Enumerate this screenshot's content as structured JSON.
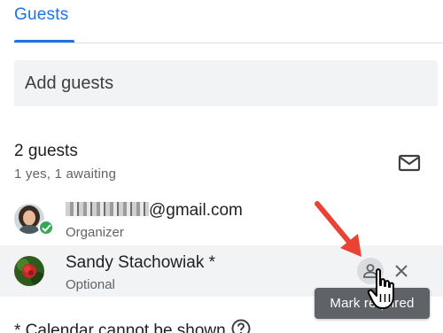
{
  "tab": {
    "label": "Guests"
  },
  "add_guests": {
    "placeholder": "Add guests"
  },
  "summary": {
    "count_label": "2 guests",
    "responses": "1 yes, 1 awaiting"
  },
  "guests": [
    {
      "email_suffix": "@gmail.com",
      "role": "Organizer",
      "status": "accepted"
    },
    {
      "name": "Sandy Stachowiak *",
      "role": "Optional"
    }
  ],
  "tooltip": {
    "text": "Mark required"
  },
  "footnote": {
    "text": "* Calendar cannot be shown"
  },
  "colors": {
    "accent": "#1a73e8",
    "accepted_check": "#34a853",
    "annotation_arrow": "#ea4335"
  },
  "icons": [
    "email-icon",
    "check-icon",
    "person-icon",
    "close-icon",
    "help-icon"
  ]
}
